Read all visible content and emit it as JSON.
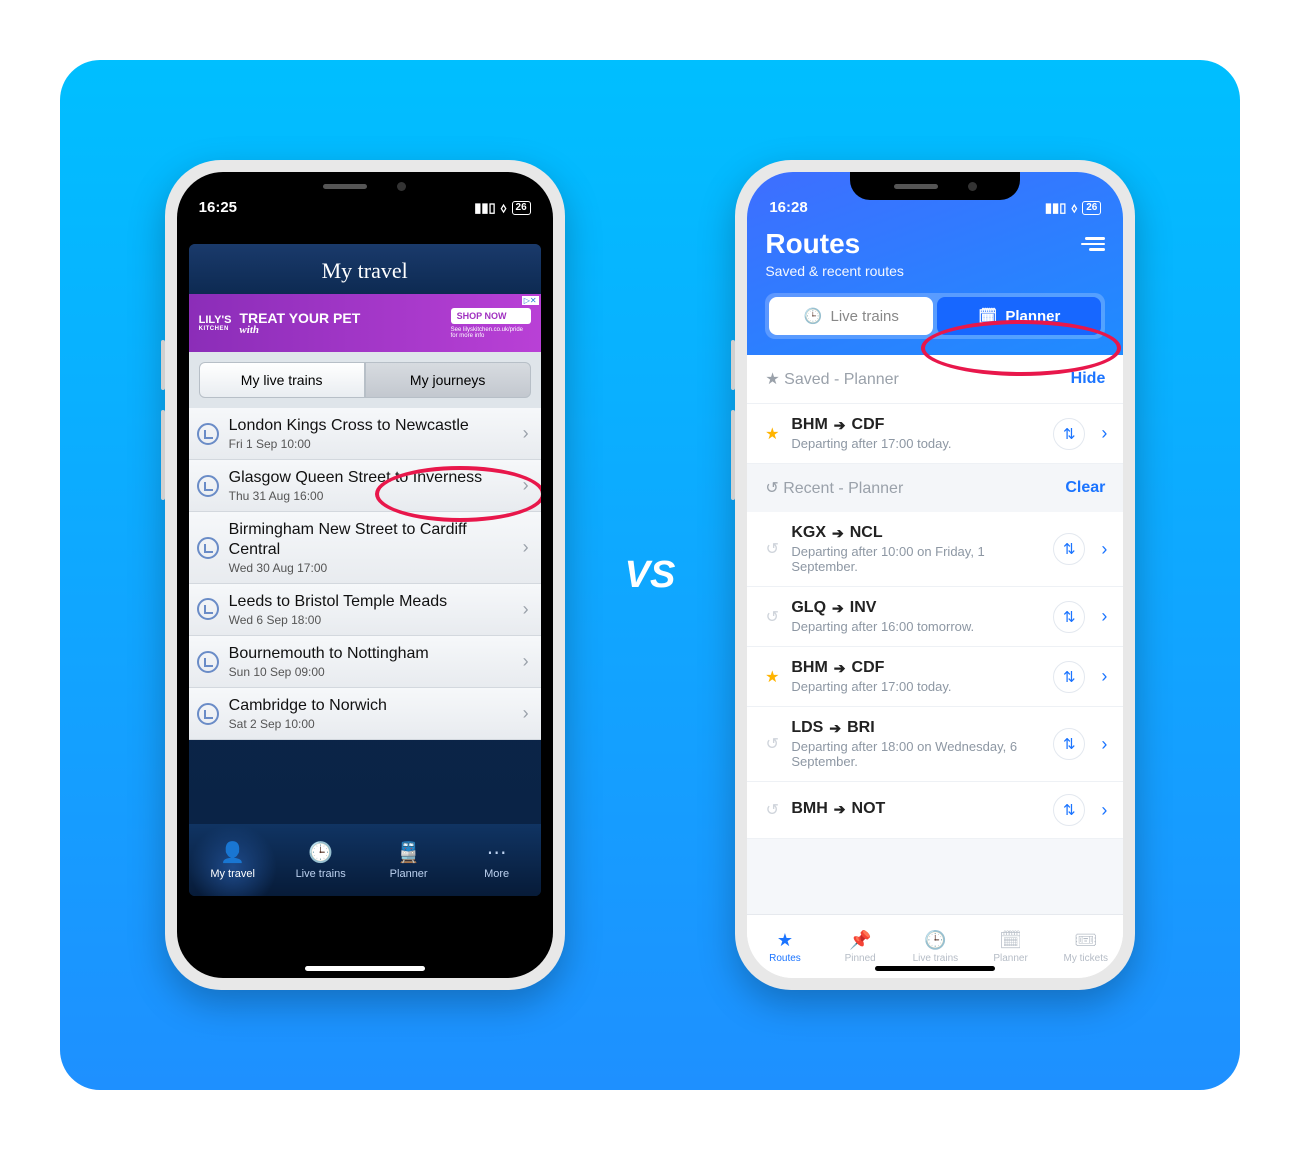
{
  "vs_label": "VS",
  "left": {
    "status": {
      "time": "16:25",
      "battery": "26"
    },
    "title": "My travel",
    "ad": {
      "brand_top": "LILY'S",
      "brand_bottom": "KITCHEN",
      "line1": "TREAT",
      "line2": "YOUR PET",
      "line3": "with",
      "cta": "SHOP NOW",
      "badge": "▷✕",
      "smallprint": "See lilyskitchen.co.uk/pride for more info"
    },
    "segments": {
      "left": "My live trains",
      "right": "My journeys"
    },
    "journeys": [
      {
        "title": "London Kings Cross to Newcastle",
        "date": "Fri 1 Sep 10:00"
      },
      {
        "title": "Glasgow Queen Street to Inverness",
        "date": "Thu 31 Aug 16:00"
      },
      {
        "title": "Birmingham New Street to Cardiff Central",
        "date": "Wed 30 Aug 17:00"
      },
      {
        "title": "Leeds to Bristol Temple Meads",
        "date": "Wed 6 Sep 18:00"
      },
      {
        "title": "Bournemouth to Nottingham",
        "date": "Sun 10 Sep 09:00"
      },
      {
        "title": "Cambridge to Norwich",
        "date": "Sat 2 Sep 10:00"
      }
    ],
    "tabs": [
      {
        "label": "My travel",
        "icon": "👤"
      },
      {
        "label": "Live trains",
        "icon": "🕒"
      },
      {
        "label": "Planner",
        "icon": "🚆"
      },
      {
        "label": "More",
        "icon": "⋯"
      }
    ]
  },
  "right": {
    "status": {
      "time": "16:28",
      "battery": "26"
    },
    "title": "Routes",
    "subtitle": "Saved & recent routes",
    "segments": {
      "left": "Live trains",
      "right": "Planner"
    },
    "saved_header": {
      "label": "Saved - Planner",
      "action": "Hide"
    },
    "saved": [
      {
        "starred": true,
        "from": "BHM",
        "to": "CDF",
        "detail": "Departing after 17:00 today."
      }
    ],
    "recent_header": {
      "label": "Recent - Planner",
      "action": "Clear"
    },
    "recent": [
      {
        "starred": false,
        "from": "KGX",
        "to": "NCL",
        "detail": "Departing after 10:00 on Friday, 1 September."
      },
      {
        "starred": false,
        "from": "GLQ",
        "to": "INV",
        "detail": "Departing after 16:00 tomorrow."
      },
      {
        "starred": true,
        "from": "BHM",
        "to": "CDF",
        "detail": "Departing after 17:00 today."
      },
      {
        "starred": false,
        "from": "LDS",
        "to": "BRI",
        "detail": "Departing after 18:00 on Wednesday, 6 September."
      },
      {
        "starred": false,
        "from": "BMH",
        "to": "NOT",
        "detail": ""
      }
    ],
    "tabs": [
      {
        "label": "Routes",
        "icon": "★"
      },
      {
        "label": "Pinned",
        "icon": "📌"
      },
      {
        "label": "Live trains",
        "icon": "🕒"
      },
      {
        "label": "Planner",
        "icon": "🗓"
      },
      {
        "label": "My tickets",
        "icon": "🎟"
      }
    ]
  }
}
